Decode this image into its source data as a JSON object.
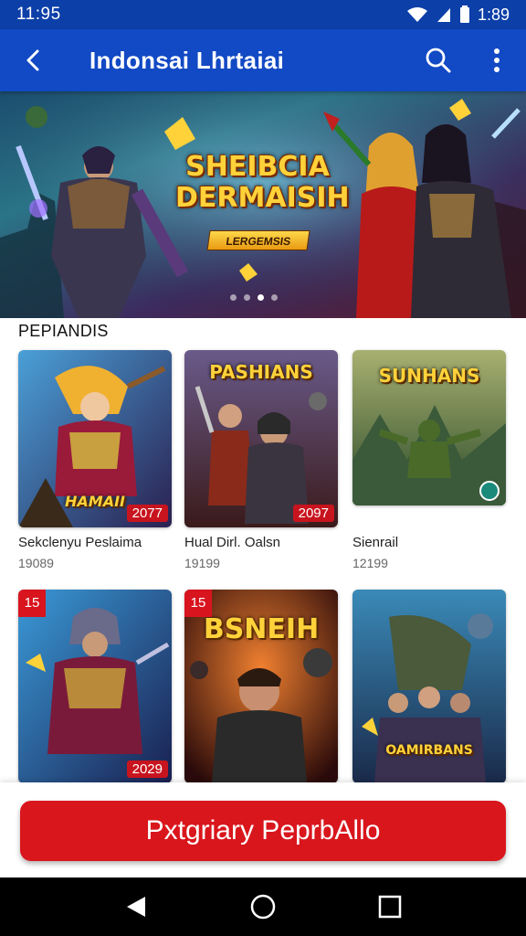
{
  "status_bar": {
    "time": "11:95",
    "clock_right": "1:89",
    "icons": [
      "wifi-icon",
      "signal-icon",
      "battery-icon"
    ]
  },
  "app_bar": {
    "title": "Indonsai Lhrtaiai",
    "icons": [
      "back-arrow-icon",
      "search-icon",
      "more-vert-icon"
    ]
  },
  "banner": {
    "title_line1": "SHEIBCIA",
    "title_line2": "DERMAISIH",
    "subtitle": "LERGEMSIS",
    "slide_count": 4,
    "active_slide": 2
  },
  "section": {
    "title": "PEPIANDIS"
  },
  "games": [
    {
      "name": "Sekclenyu Peslaima",
      "count": "19089",
      "art_text": "HAMAII",
      "year": "2077"
    },
    {
      "name": "Hual Dirl. Oalsn",
      "count": "19199",
      "art_text": "PASHIANS",
      "year": "2097"
    },
    {
      "name": "Sienrail",
      "count": "12199",
      "art_text": "SUNHANS",
      "year": ""
    },
    {
      "name": "",
      "count": "",
      "art_text": "",
      "year": "2029",
      "corner_badge": "15"
    },
    {
      "name": "",
      "count": "",
      "art_text": "BSNEIH",
      "year": "",
      "corner_badge": "15"
    },
    {
      "name": "",
      "count": "",
      "art_text": "OAMIRBANS",
      "year": ""
    }
  ],
  "cta": {
    "label": "Pxtgriary PeprbAllo"
  },
  "nav": {
    "icons": [
      "back-triangle-icon",
      "home-circle-icon",
      "recents-square-icon"
    ]
  },
  "colors": {
    "primary": "#1249c4",
    "status": "#0c3fa8",
    "accent": "#d9161c",
    "gold": "#ffd23a"
  }
}
